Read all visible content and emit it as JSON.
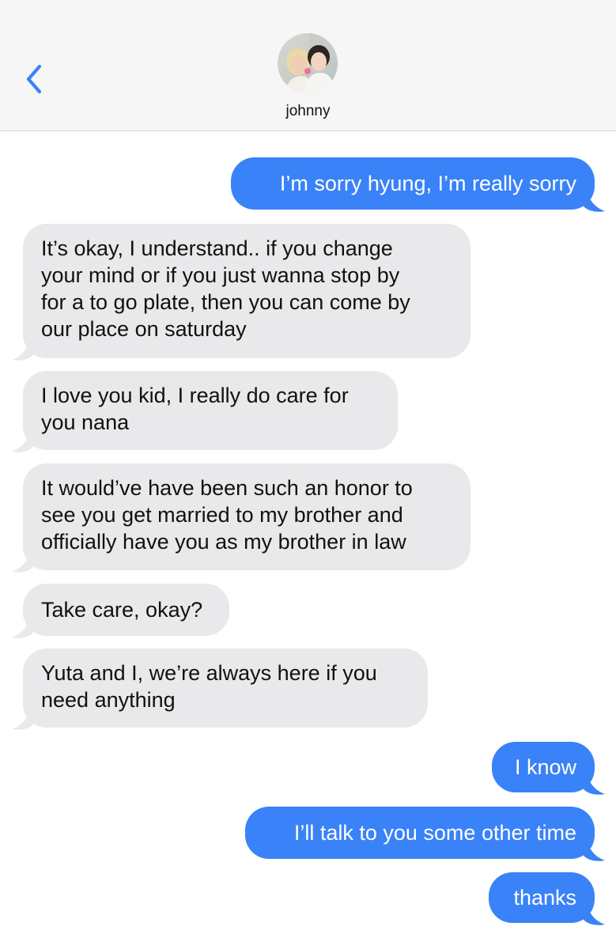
{
  "header": {
    "contact_name": "johnny",
    "back_icon": "chevron-left-icon",
    "accent_color": "#3a82f7"
  },
  "colors": {
    "outgoing_bubble": "#3a82f7",
    "incoming_bubble": "#e9e9eb",
    "header_background": "#f6f6f6"
  },
  "messages": [
    {
      "direction": "outgoing",
      "text": "I’m sorry hyung, I’m really sorry"
    },
    {
      "direction": "incoming",
      "lines": [
        "It’s okay, I understand.. if you change",
        "your mind or if you just wanna stop by",
        "for a to go plate, then you can come by",
        "our place on saturday"
      ]
    },
    {
      "direction": "incoming",
      "lines": [
        "I love you kid, I really do care for",
        "you nana"
      ]
    },
    {
      "direction": "incoming",
      "lines": [
        "It would’ve have been such an honor to",
        "see you get married to my brother and",
        "officially have you as my brother in law"
      ]
    },
    {
      "direction": "incoming",
      "text": "Take care, okay?"
    },
    {
      "direction": "incoming",
      "lines": [
        "Yuta and I, we’re always here if you",
        "need anything"
      ]
    },
    {
      "direction": "outgoing",
      "text": "I know"
    },
    {
      "direction": "outgoing",
      "text": "I’ll talk to you some other time"
    },
    {
      "direction": "outgoing",
      "text": "thanks"
    }
  ]
}
